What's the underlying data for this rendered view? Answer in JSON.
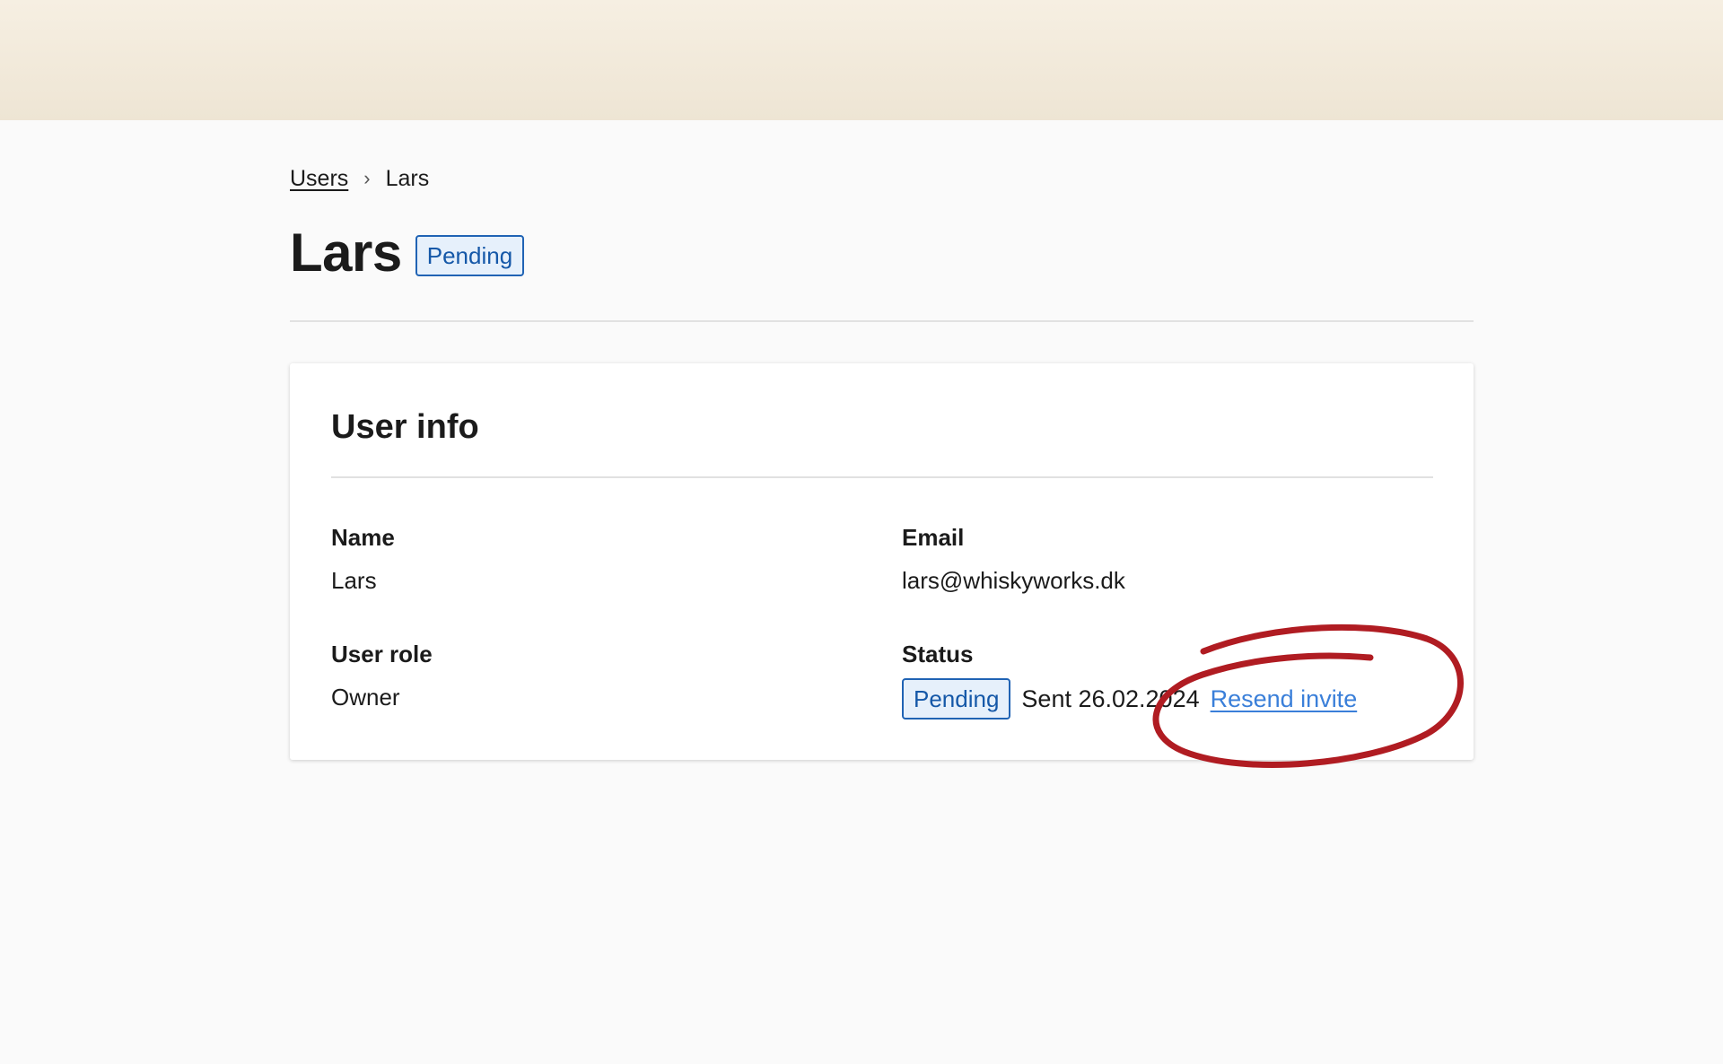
{
  "breadcrumb": {
    "parent": "Users",
    "separator": "›",
    "current": "Lars"
  },
  "header": {
    "title": "Lars",
    "status_badge": "Pending"
  },
  "user_info": {
    "title": "User info",
    "name_label": "Name",
    "name_value": "Lars",
    "email_label": "Email",
    "email_value": "lars@whiskyworks.dk",
    "role_label": "User role",
    "role_value": "Owner",
    "status_label": "Status",
    "status_badge": "Pending",
    "sent_text": "Sent 26.02.2024",
    "resend_label": "Resend invite"
  },
  "colors": {
    "banner": "#f4ecdf",
    "badge_border": "#2063b4",
    "badge_fill": "#e6f0fb",
    "link": "#3a7fd9",
    "annotation_circle": "#b01c22"
  }
}
